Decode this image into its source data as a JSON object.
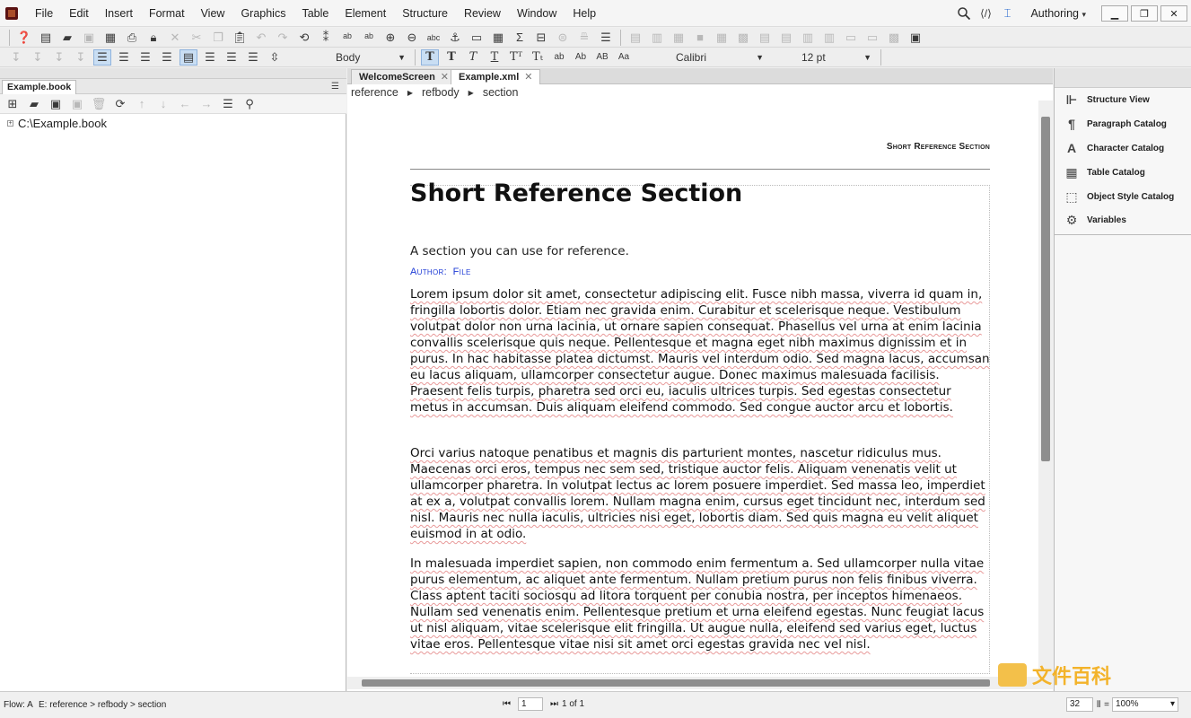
{
  "menubar": {
    "items": [
      "File",
      "Edit",
      "Insert",
      "Format",
      "View",
      "Graphics",
      "Table",
      "Element",
      "Structure",
      "Review",
      "Window",
      "Help"
    ],
    "workspace": "Authoring"
  },
  "format_bar": {
    "paragraph_style": "Body",
    "font": "Calibri",
    "size": "12 pt",
    "char_buttons": [
      "ab",
      "Ab",
      "AB",
      "Aa"
    ]
  },
  "left_panel": {
    "tab": "Example.book",
    "tree_root": "C:\\Example.book"
  },
  "doc_tabs": [
    {
      "label": "WelcomeScreen"
    },
    {
      "label": "Example.xml"
    }
  ],
  "breadcrumb": [
    "reference",
    "refbody",
    "section"
  ],
  "document": {
    "running_head": "Short Reference Section",
    "title": "Short Reference Section",
    "shortdesc": "A section you can use for reference.",
    "author_label": "Author:",
    "author_value": "File",
    "paragraphs": [
      "Lorem ipsum dolor sit amet, consectetur adipiscing elit. Fusce nibh massa, viverra id quam in, fringilla lobortis dolor. Etiam nec gravida enim. Curabitur et scelerisque neque. Vestibulum volutpat dolor non urna lacinia, ut ornare sapien consequat. Phasellus vel urna at enim lacinia convallis scelerisque quis neque. Pellentesque et magna eget nibh maximus dignissim et in purus. In hac habitasse platea dictumst. Mauris vel interdum odio. Sed magna lacus, accumsan eu lacus aliquam, ullamcorper consectetur augue. Donec maximus malesuada facilisis. Praesent felis turpis, pharetra sed orci eu, iaculis ultrices turpis. Sed egestas consectetur metus in accumsan. Duis aliquam eleifend commodo. Sed congue auctor arcu et lobortis.",
      "Orci varius natoque penatibus et magnis dis parturient montes, nascetur ridiculus mus. Maecenas orci eros, tempus nec sem sed, tristique auctor felis. Aliquam venenatis velit ut ullamcorper pharetra. In volutpat lectus ac lorem posuere imperdiet. Sed massa leo, imperdiet at ex a, volutpat convallis lorem. Nullam magna enim, cursus eget tincidunt nec, interdum sed nisl. Mauris nec nulla iaculis, ultricies nisi eget, lobortis diam. Sed quis magna eu velit aliquet euismod in at odio.",
      "In malesuada imperdiet sapien, non commodo enim fermentum a. Sed ullamcorper nulla vitae purus elementum, ac aliquet ante fermentum. Nullam pretium purus non felis finibus viverra. Class aptent taciti sociosqu ad litora torquent per conubia nostra, per inceptos himenaeos. Nullam sed venenatis enim. Pellentesque pretium et urna eleifend egestas. Nunc feugiat lacus ut nisl aliquam, vitae scelerisque elit fringilla. Ut augue nulla, eleifend sed varius eget, luctus vitae eros. Pellentesque vitae nisi sit amet orci egestas gravida nec vel nisl."
    ]
  },
  "right_panel": {
    "items": [
      "Structure View",
      "Paragraph Catalog",
      "Character Catalog",
      "Table Catalog",
      "Object Style Catalog",
      "Variables"
    ]
  },
  "watermark": "文件百科",
  "statusbar": {
    "flow": "Flow: A",
    "element": "E: reference > refbody > section",
    "page_value": "1",
    "page_count": "1 of 1",
    "value_32": "32",
    "zoom": "100%"
  },
  "colors": {
    "accent": "#1f3cd6",
    "toolbar_active": "#c9def3",
    "watermark": "#f3b32a"
  }
}
